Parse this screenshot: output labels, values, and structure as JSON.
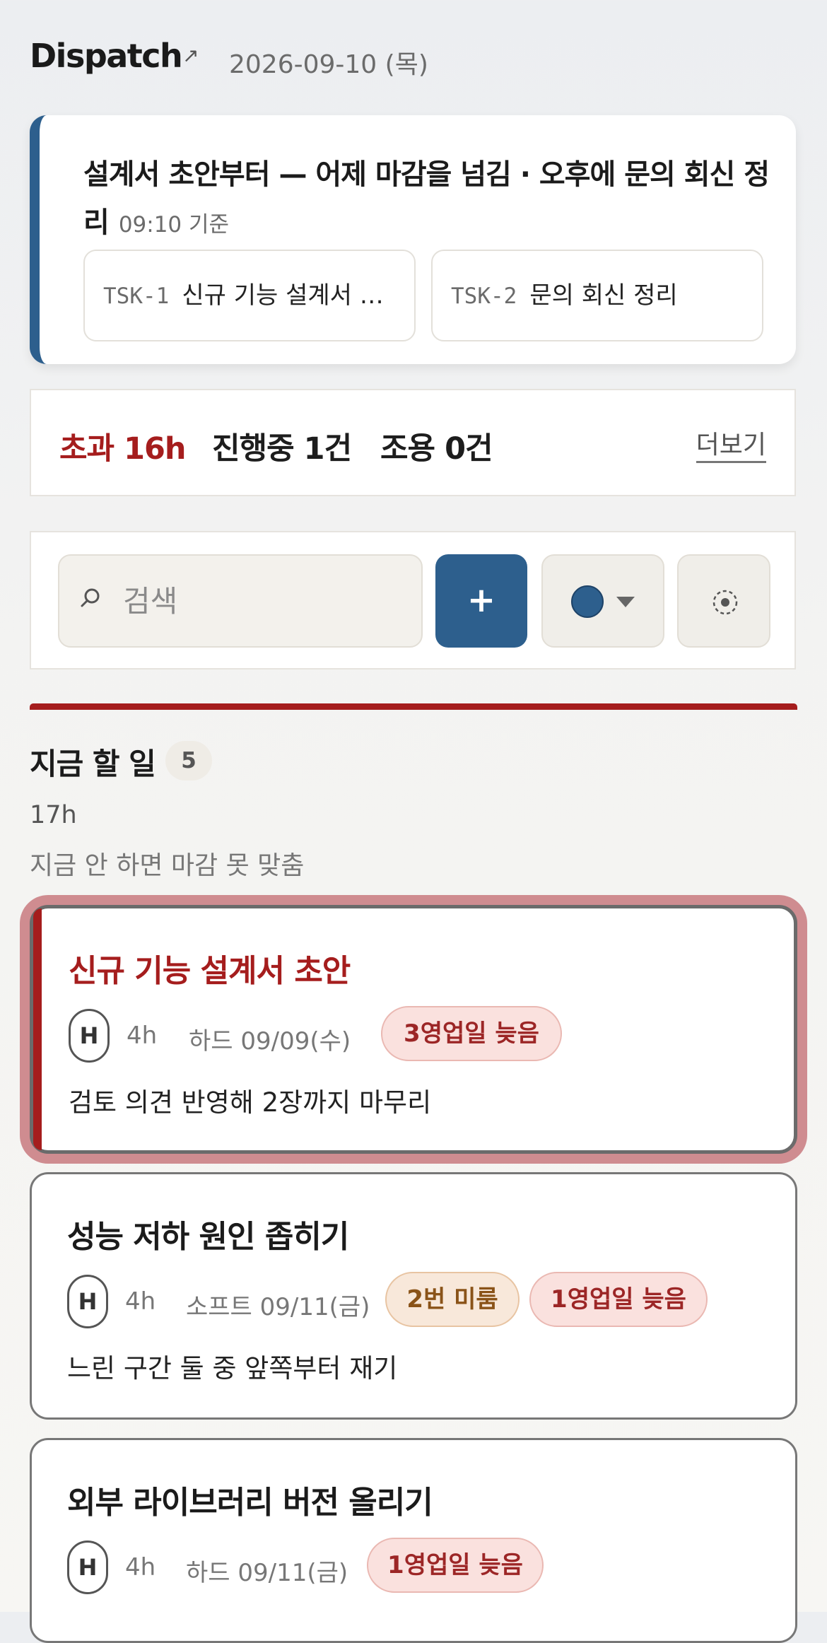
{
  "header": {
    "title": "Dispatch",
    "date": "2026-09-10 (목)"
  },
  "summary": {
    "headline": "설계서 초안부터 — 어제 마감을 넘김 · 오후에 문의 회신 정리",
    "as_of": "09:10 기준",
    "chips": [
      {
        "code": "TSK-1",
        "label": "신규 기능 설계서 …"
      },
      {
        "code": "TSK-2",
        "label": "문의 회신 정리"
      }
    ]
  },
  "stats": {
    "overdue": "초과 16h",
    "in_progress": "진행중 1건",
    "quiet": "조용 0건",
    "more_label": "더보기"
  },
  "toolbar": {
    "search_placeholder": "검색",
    "add_label": "+",
    "color_value": "#2d5f8d"
  },
  "section": {
    "title": "지금 할 일",
    "count": "5",
    "hours": "17h",
    "description": "지금 안 하면 마감 못 맞춤"
  },
  "tasks": [
    {
      "title": "신규 기능 설계서 초안",
      "priority": "H",
      "hours": "4h",
      "deadline": "하드 09/09(수)",
      "badges": [
        "3영업일 늦음"
      ],
      "note": "검토 의견 반영해 2장까지 마무리"
    },
    {
      "title": "성능 저하 원인 좁히기",
      "priority": "H",
      "hours": "4h",
      "deadline": "소프트 09/11(금)",
      "badges": [
        "2번 미룸",
        "1영업일 늦음"
      ],
      "note": "느린 구간 둘 중 앞쪽부터 재기"
    },
    {
      "title": "외부 라이브러리 버전 올리기",
      "priority": "H",
      "hours": "4h",
      "deadline": "하드 09/11(금)",
      "badges": [
        "1영업일 늦음"
      ],
      "note": ""
    }
  ],
  "colors": {
    "accent": "#2d5f8d",
    "danger": "#a51d1d"
  },
  "icons": [
    "external-link-icon",
    "search-icon",
    "plus-icon",
    "chevron-down-icon",
    "target-icon"
  ]
}
